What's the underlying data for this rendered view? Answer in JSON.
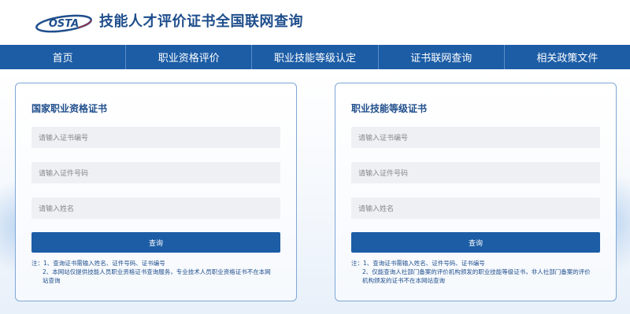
{
  "header": {
    "logo_text": "OSTA",
    "title": "技能人才评价证书全国联网查询"
  },
  "nav": {
    "items": [
      "首页",
      "职业资格评价",
      "职业技能等级认定",
      "证书联网查询",
      "相关政策文件"
    ]
  },
  "left_panel": {
    "title": "国家职业资格证书",
    "cert_no_placeholder": "请输入证书编号",
    "id_no_placeholder": "请输入证件号码",
    "name_placeholder": "请输入姓名",
    "query_button": "查询",
    "notes": [
      "注：1、查询证书需输入姓名、证件号码、证书编号",
      "2、本网站仅提供技能人员职业资格证书查询服务，专业技术人员职业资格证书不在本网",
      "站查询"
    ]
  },
  "right_panel": {
    "title": "职业技能等级证书",
    "cert_no_placeholder": "请输入证书编号",
    "id_no_placeholder": "请输入证件号码",
    "name_placeholder": "请输入姓名",
    "query_button": "查询",
    "notes": [
      "注：1、查询证书需输入姓名、证件号码、证书编号",
      "2、仅能查询人社部门备案的评价机构颁发的职业技能等级证书，非人社部门备案的评价",
      "机构颁发的证书不在本网站查询"
    ]
  },
  "colors": {
    "brand_blue": "#1c5da6",
    "title_blue": "#1f4e8c",
    "input_bg": "#eef0f3",
    "panel_border": "#7fa7d6"
  },
  "icons": {
    "logo": "osta-logo"
  }
}
